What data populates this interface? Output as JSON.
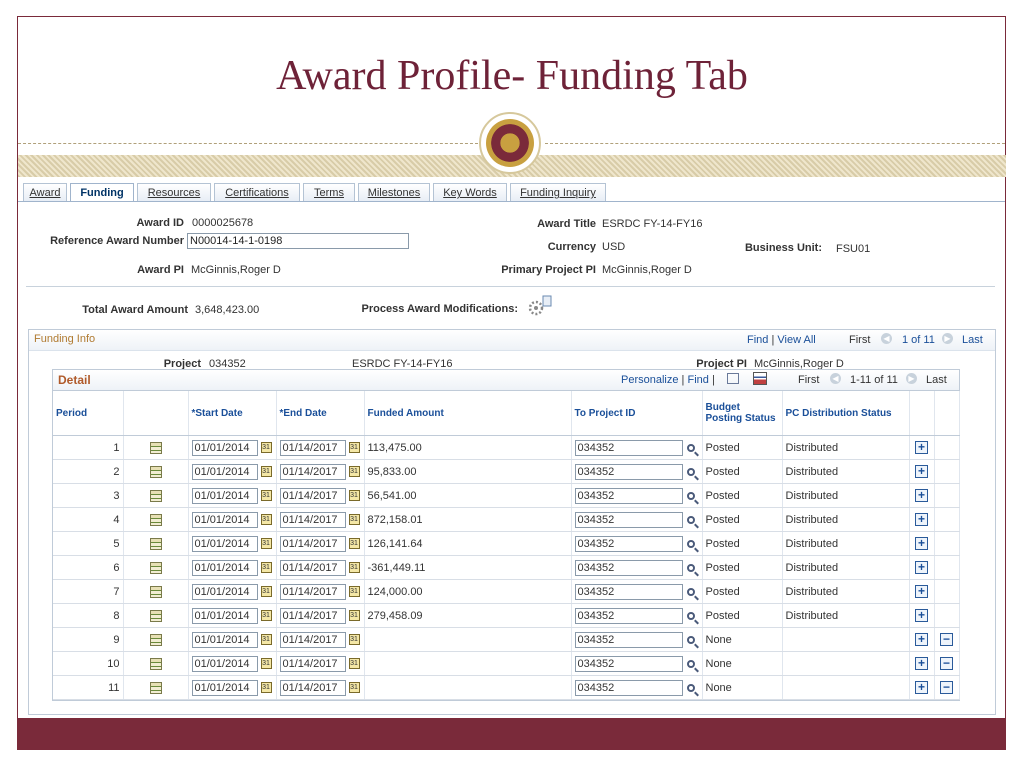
{
  "slide": {
    "title": "Award Profile- Funding Tab"
  },
  "tabs": [
    "Award",
    "Funding",
    "Resources",
    "Certifications",
    "Terms",
    "Milestones",
    "Key Words",
    "Funding Inquiry"
  ],
  "award": {
    "award_id_label": "Award ID",
    "award_id": "0000025678",
    "ref_label": "Reference Award Number",
    "ref_value": "N00014-14-1-0198",
    "pi_label": "Award PI",
    "pi": "McGinnis,Roger D",
    "title_label": "Award Title",
    "title": "ESRDC FY-14-FY16",
    "currency_label": "Currency",
    "currency": "USD",
    "bu_label": "Business Unit:",
    "bu": "FSU01",
    "ppi_label": "Primary Project PI",
    "ppi": "McGinnis,Roger D",
    "total_label": "Total Award Amount",
    "total": "3,648,423.00",
    "process_label": "Process Award Modifications:"
  },
  "funding": {
    "section_label": "Funding Info",
    "find": "Find",
    "view_all": "View All",
    "first": "First",
    "count": "1 of 11",
    "last": "Last",
    "project_label": "Project",
    "project": "034352",
    "project_desc": "ESRDC FY-14-FY16",
    "project_pi_label": "Project PI",
    "project_pi": "McGinnis,Roger D"
  },
  "detail": {
    "label": "Detail",
    "personalize": "Personalize",
    "find": "Find",
    "first": "First",
    "count": "1-11 of 11",
    "last": "Last",
    "columns": [
      "Period",
      "",
      "*Start Date",
      "*End Date",
      "Funded Amount",
      "To Project ID",
      "Budget Posting Status",
      "PC Distribution Status",
      "",
      ""
    ],
    "rows": [
      {
        "period": "1",
        "start": "01/01/2014",
        "end": "01/14/2017",
        "amount": "113,475.00",
        "project": "034352",
        "budget": "Posted",
        "pc": "Distributed"
      },
      {
        "period": "2",
        "start": "01/01/2014",
        "end": "01/14/2017",
        "amount": "95,833.00",
        "project": "034352",
        "budget": "Posted",
        "pc": "Distributed"
      },
      {
        "period": "3",
        "start": "01/01/2014",
        "end": "01/14/2017",
        "amount": "56,541.00",
        "project": "034352",
        "budget": "Posted",
        "pc": "Distributed"
      },
      {
        "period": "4",
        "start": "01/01/2014",
        "end": "01/14/2017",
        "amount": "872,158.01",
        "project": "034352",
        "budget": "Posted",
        "pc": "Distributed"
      },
      {
        "period": "5",
        "start": "01/01/2014",
        "end": "01/14/2017",
        "amount": "126,141.64",
        "project": "034352",
        "budget": "Posted",
        "pc": "Distributed"
      },
      {
        "period": "6",
        "start": "01/01/2014",
        "end": "01/14/2017",
        "amount": "-361,449.11",
        "project": "034352",
        "budget": "Posted",
        "pc": "Distributed"
      },
      {
        "period": "7",
        "start": "01/01/2014",
        "end": "01/14/2017",
        "amount": "124,000.00",
        "project": "034352",
        "budget": "Posted",
        "pc": "Distributed"
      },
      {
        "period": "8",
        "start": "01/01/2014",
        "end": "01/14/2017",
        "amount": "279,458.09",
        "project": "034352",
        "budget": "Posted",
        "pc": "Distributed"
      },
      {
        "period": "9",
        "start": "01/01/2014",
        "end": "01/14/2017",
        "amount": "",
        "project": "034352",
        "budget": "None",
        "pc": "",
        "minus": true
      },
      {
        "period": "10",
        "start": "01/01/2014",
        "end": "01/14/2017",
        "amount": "",
        "project": "034352",
        "budget": "None",
        "pc": "",
        "minus": true
      },
      {
        "period": "11",
        "start": "01/01/2014",
        "end": "01/14/2017",
        "amount": "",
        "project": "034352",
        "budget": "None",
        "pc": "",
        "minus": true
      }
    ]
  }
}
